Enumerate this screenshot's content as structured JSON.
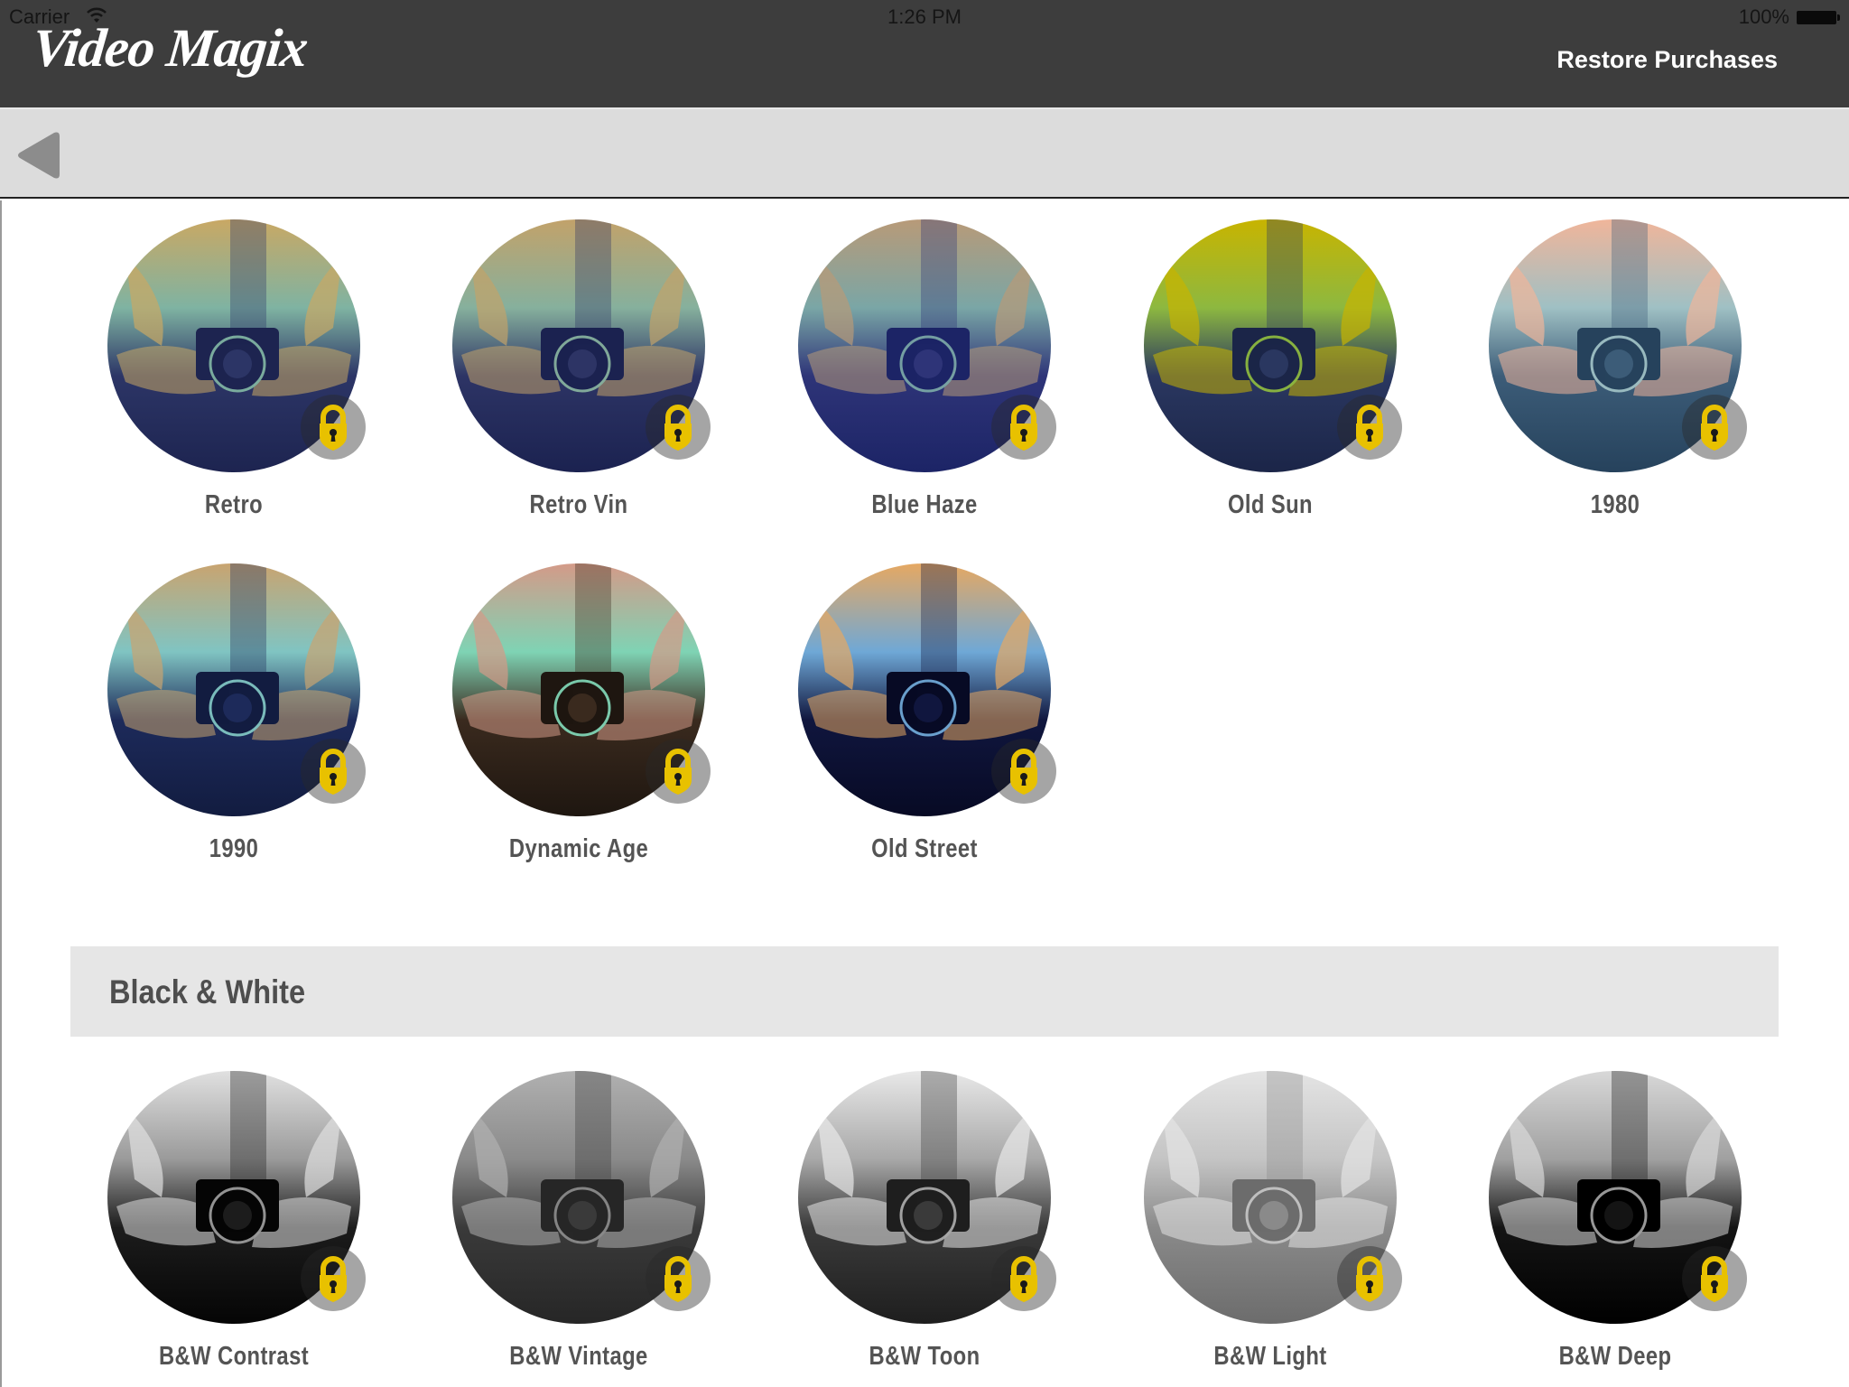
{
  "status_bar": {
    "carrier": "Carrier",
    "time": "1:26 PM",
    "battery": "100%",
    "wifi_icon": "wifi-icon",
    "battery_icon": "battery-icon"
  },
  "header": {
    "logo": "Video Magix",
    "restore_label": "Restore Purchases"
  },
  "toolbar": {
    "back_icon": "back-triangle-icon"
  },
  "colors": {
    "header_bg": "#3d3d3d",
    "toolbar_bg": "#dcdcdc",
    "lock_yellow": "#e8c100",
    "section_bg": "#e6e6e6",
    "label_text": "#545454"
  },
  "filters": [
    {
      "label": "Retro",
      "locked": true,
      "palette": [
        "#c9a864",
        "#7fb3a2",
        "#2c3566",
        "#1d2450"
      ]
    },
    {
      "label": "Retro Vin",
      "locked": true,
      "palette": [
        "#c2a26a",
        "#86b09d",
        "#2d3465",
        "#1b2250"
      ]
    },
    {
      "label": "Blue Haze",
      "locked": true,
      "palette": [
        "#b89a78",
        "#7aa6a6",
        "#2e3478",
        "#1c2466"
      ]
    },
    {
      "label": "Old Sun",
      "locked": true,
      "palette": [
        "#c8b400",
        "#8db840",
        "#2a3760",
        "#1b2548"
      ]
    },
    {
      "label": "1980",
      "locked": true,
      "palette": [
        "#f0b59a",
        "#9fc0c4",
        "#3c5c78",
        "#26425c"
      ]
    },
    {
      "label": "1990",
      "locked": true,
      "palette": [
        "#c9a470",
        "#80c4c2",
        "#1d2a5a",
        "#121c40"
      ]
    },
    {
      "label": "Dynamic Age",
      "locked": true,
      "palette": [
        "#d49a88",
        "#7fd3b4",
        "#3a2a1e",
        "#1e1610"
      ]
    },
    {
      "label": "Old Street",
      "locked": true,
      "palette": [
        "#e6a862",
        "#6fa8d6",
        "#10163e",
        "#070a24"
      ]
    }
  ],
  "section": {
    "title": "Black & White"
  },
  "bw_filters": [
    {
      "label": "B&W Contrast",
      "locked": true,
      "palette": [
        "#e0e0e0",
        "#9a9a9a",
        "#1c1c1c",
        "#050505"
      ]
    },
    {
      "label": "B&W Vintage",
      "locked": true,
      "palette": [
        "#b0b0b0",
        "#8a8a8a",
        "#3a3a3a",
        "#262626"
      ]
    },
    {
      "label": "B&W Toon",
      "locked": true,
      "palette": [
        "#e8e8e8",
        "#a8a8a8",
        "#3a3a3a",
        "#1e1e1e"
      ]
    },
    {
      "label": "B&W Light",
      "locked": true,
      "palette": [
        "#e4e4e4",
        "#c4c4c4",
        "#8a8a8a",
        "#6c6c6c"
      ]
    },
    {
      "label": "B&W Deep",
      "locked": true,
      "palette": [
        "#d8d8d8",
        "#a0a0a0",
        "#141414",
        "#000000"
      ]
    }
  ]
}
